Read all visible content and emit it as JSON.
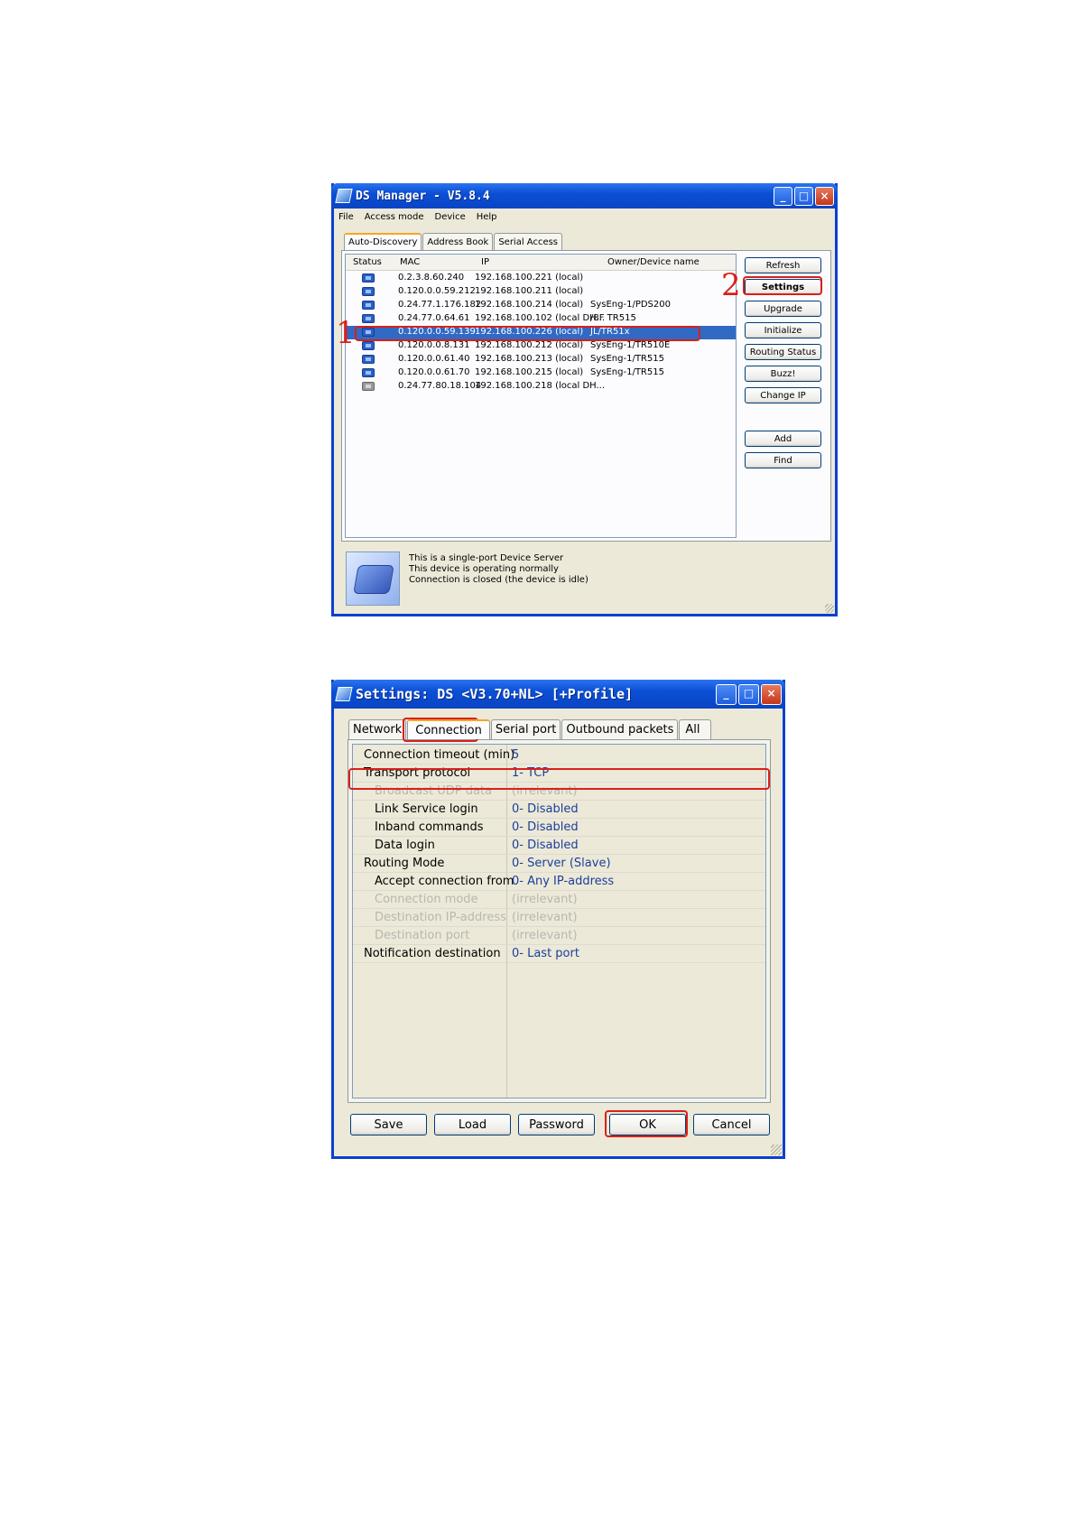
{
  "ds_manager": {
    "title": "DS Manager - V5.8.4",
    "menu": [
      "File",
      "Access mode",
      "Device",
      "Help"
    ],
    "tabs": [
      "Auto-Discovery",
      "Address Book",
      "Serial Access"
    ],
    "columns": [
      "Status",
      "MAC",
      "IP",
      "Owner/Device name"
    ],
    "rows": [
      {
        "mac": "0.2.3.8.60.240",
        "ip": "192.168.100.221 (local)",
        "owner": "",
        "status": "online"
      },
      {
        "mac": "0.120.0.0.59.212",
        "ip": "192.168.100.211 (local)",
        "owner": "",
        "status": "online"
      },
      {
        "mac": "0.24.77.1.176.182",
        "ip": "192.168.100.214 (local)",
        "owner": "SysEng-1/PDS200",
        "status": "online"
      },
      {
        "mac": "0.24.77.0.64.61",
        "ip": "192.168.100.102 (local DH...",
        "owner": "/8F TR515",
        "status": "online"
      },
      {
        "mac": "0.120.0.0.59.139",
        "ip": "192.168.100.226 (local)",
        "owner": "JL/TR51x",
        "status": "online"
      },
      {
        "mac": "0.120.0.0.8.131",
        "ip": "192.168.100.212 (local)",
        "owner": "SysEng-1/TR510E",
        "status": "online"
      },
      {
        "mac": "0.120.0.0.61.40",
        "ip": "192.168.100.213 (local)",
        "owner": "SysEng-1/TR515",
        "status": "online"
      },
      {
        "mac": "0.120.0.0.61.70",
        "ip": "192.168.100.215 (local)",
        "owner": "SysEng-1/TR515",
        "status": "online"
      },
      {
        "mac": "0.24.77.80.18.104",
        "ip": "192.168.100.218 (local DH...",
        "owner": "",
        "status": "offline"
      }
    ],
    "selected_row": 4,
    "buttons": {
      "refresh": "Refresh",
      "settings": "Settings",
      "upgrade": "Upgrade",
      "initialize": "Initialize",
      "routing_status": "Routing Status",
      "buzz": "Buzz!",
      "change_ip": "Change IP",
      "add": "Add",
      "find": "Find"
    },
    "status_lines": [
      "This is a single-port Device Server",
      "This device is operating normally",
      "Connection is closed (the device is idle)"
    ],
    "annotations": [
      "1",
      "2"
    ]
  },
  "settings": {
    "title": "Settings: DS <V3.70+NL> [+Profile]",
    "tabs": [
      "Network",
      "Connection",
      "Serial port",
      "Outbound packets",
      "All"
    ],
    "active_tab": "Connection",
    "rows": [
      {
        "key": "Connection timeout (min)",
        "value": "5"
      },
      {
        "key": "Transport protocol",
        "value": "1- TCP"
      },
      {
        "key": "Broadcast UDP data",
        "value": "(irrelevant)"
      },
      {
        "key": "Link Service login",
        "value": "0- Disabled"
      },
      {
        "key": "Inband commands",
        "value": "0- Disabled"
      },
      {
        "key": "Data login",
        "value": "0- Disabled"
      },
      {
        "key": "Routing Mode",
        "value": "0- Server (Slave)"
      },
      {
        "key": "Accept connection from",
        "value": "0- Any IP-address"
      },
      {
        "key": "Connection mode",
        "value": "(irrelevant)"
      },
      {
        "key": "Destination IP-address",
        "value": "(irrelevant)"
      },
      {
        "key": "Destination port",
        "value": "(irrelevant)"
      },
      {
        "key": "Notification destination",
        "value": "0- Last port"
      }
    ],
    "buttons": {
      "save": "Save",
      "load": "Load",
      "password": "Password",
      "ok": "OK",
      "cancel": "Cancel"
    }
  },
  "colors": {
    "highlight": "#d9201b",
    "selection": "#316ac5",
    "title_blue": "#0b4fd6"
  }
}
